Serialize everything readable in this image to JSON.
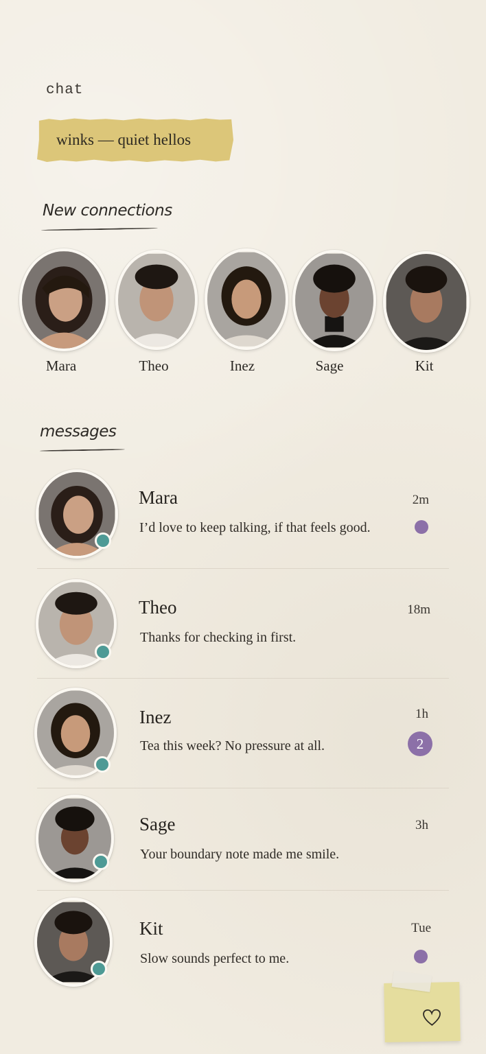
{
  "header": {
    "title": "chat"
  },
  "winks_tape": {
    "label": "winks — quiet hellos"
  },
  "new_connections": {
    "heading": "New connections",
    "people": [
      {
        "name": "Mara"
      },
      {
        "name": "Theo"
      },
      {
        "name": "Inez"
      },
      {
        "name": "Sage"
      },
      {
        "name": "Kit"
      }
    ]
  },
  "messages": {
    "heading": "messages",
    "rows": [
      {
        "name": "Mara",
        "preview": "I’d love to keep talking, if that feels good.",
        "time": "2m",
        "online": true,
        "unread_dot": true
      },
      {
        "name": "Theo",
        "preview": "Thanks for checking in first.",
        "time": "18m",
        "online": true
      },
      {
        "name": "Inez",
        "preview": "Tea this week? No pressure at all.",
        "time": "1h",
        "online": true,
        "unread_count": "2"
      },
      {
        "name": "Sage",
        "preview": "Your boundary note made me smile.",
        "time": "3h",
        "online": true
      },
      {
        "name": "Kit",
        "preview": "Slow sounds perfect to me.",
        "time": "Tue",
        "online": true,
        "unread_dot": true
      }
    ]
  },
  "colors": {
    "accent_purple": "#8c70a8",
    "online_teal": "#4e9a95",
    "tape_yellow": "#dcc679",
    "paper": "#f1ece1"
  },
  "fab": {
    "icon": "heart-icon"
  }
}
